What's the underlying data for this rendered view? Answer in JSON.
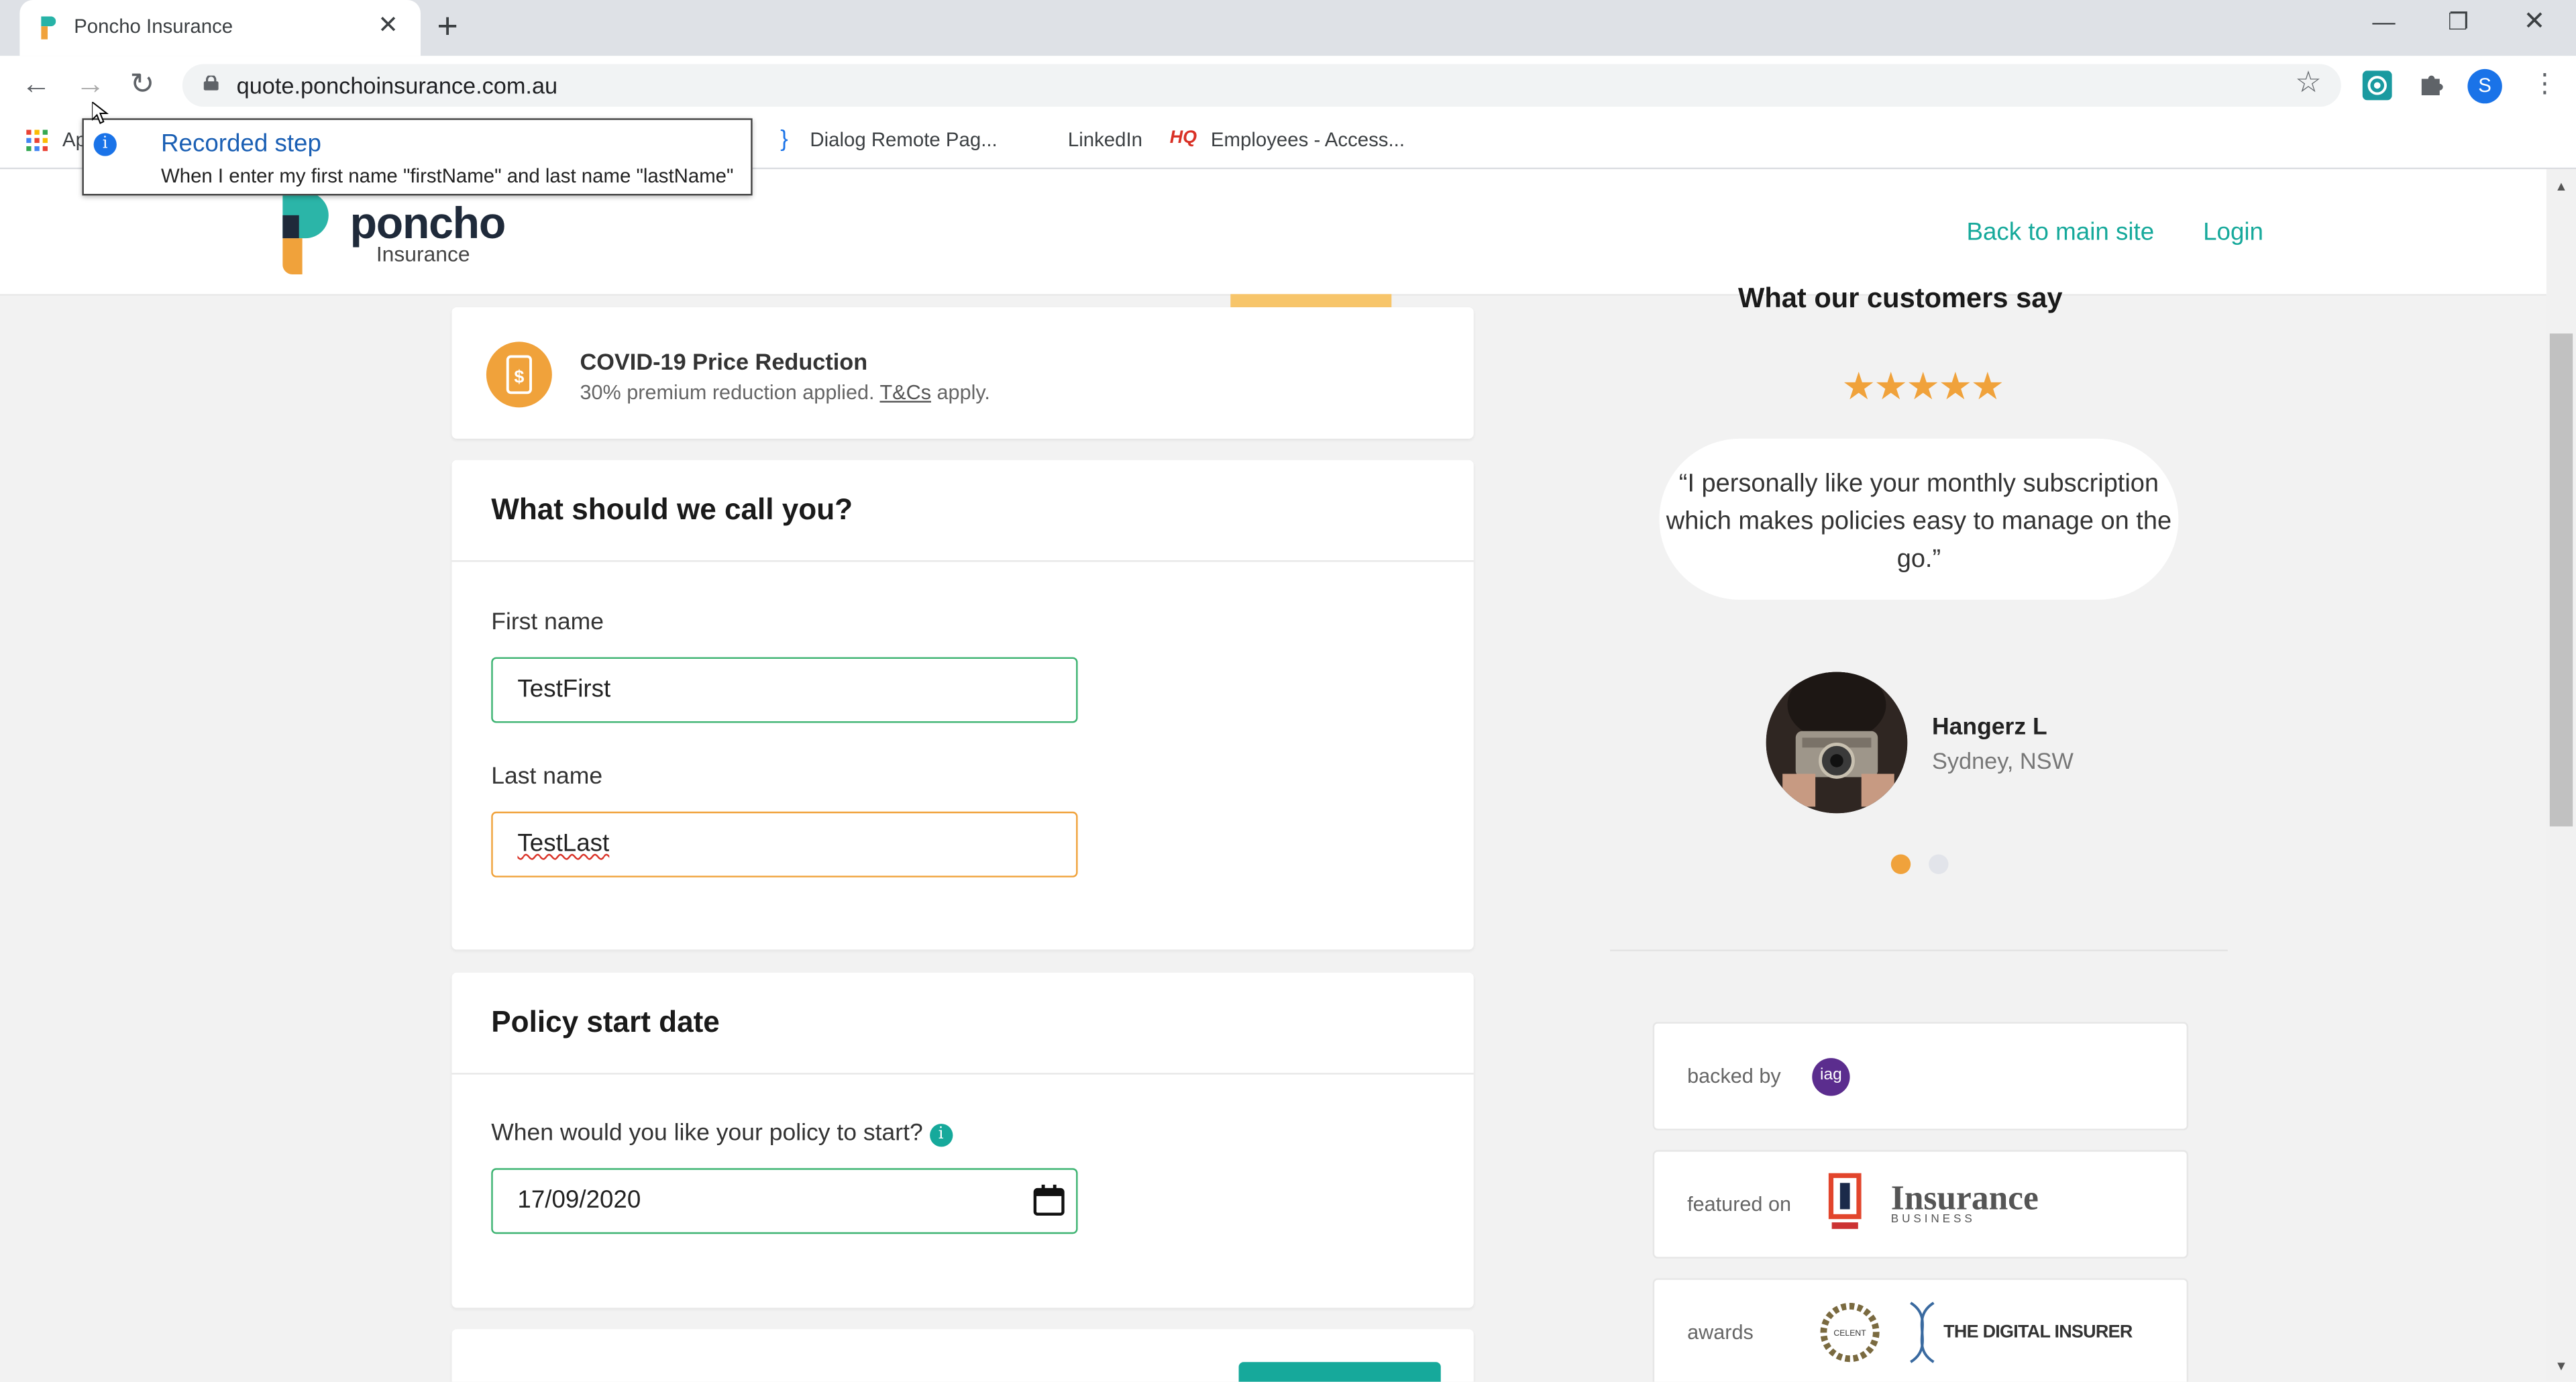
{
  "browser": {
    "tab_title": "Poncho Insurance",
    "url": "quote.ponchoinsurance.com.au",
    "profile_initial": "S",
    "bookmarks": [
      "Ap",
      "Dialog Remote Pag...",
      "LinkedIn",
      "Employees - Access..."
    ]
  },
  "tooltip": {
    "title": "Recorded step",
    "body": "When I enter my first name \"firstName\" and last name \"lastName\""
  },
  "header": {
    "logo_text": "poncho",
    "logo_sub": "Insurance",
    "back_link": "Back to main site",
    "login_link": "Login"
  },
  "covid": {
    "title": "COVID-19 Price Reduction",
    "subtitle_pre": "30% premium reduction applied. ",
    "subtitle_link": "T&Cs",
    "subtitle_post": " apply."
  },
  "name_form": {
    "heading": "What should we call you?",
    "first_label": "First name",
    "first_value": "TestFirst",
    "last_label": "Last name",
    "last_value": "TestLast"
  },
  "policy": {
    "heading": "Policy start date",
    "question": "When would you like your policy to start?",
    "date_value": "17/09/2020"
  },
  "reviews": {
    "title": "What our customers say",
    "stars": "★★★★★",
    "quote": "“I personally like your monthly subscription which makes policies easy to manage on the go.”",
    "name": "Hangerz L",
    "location": "Sydney, NSW"
  },
  "badges": {
    "backed_by": "backed by",
    "backed_logo": "iag",
    "featured_on": "featured on",
    "featured_logo": "Insurance",
    "featured_logo_sub": "BUSINESS",
    "awards": "awards",
    "award_logo": "THE DIGITAL INSURER"
  },
  "colors": {
    "accent_teal": "#16a99b",
    "accent_orange": "#f0a23b",
    "valid_green": "#3cb371"
  }
}
